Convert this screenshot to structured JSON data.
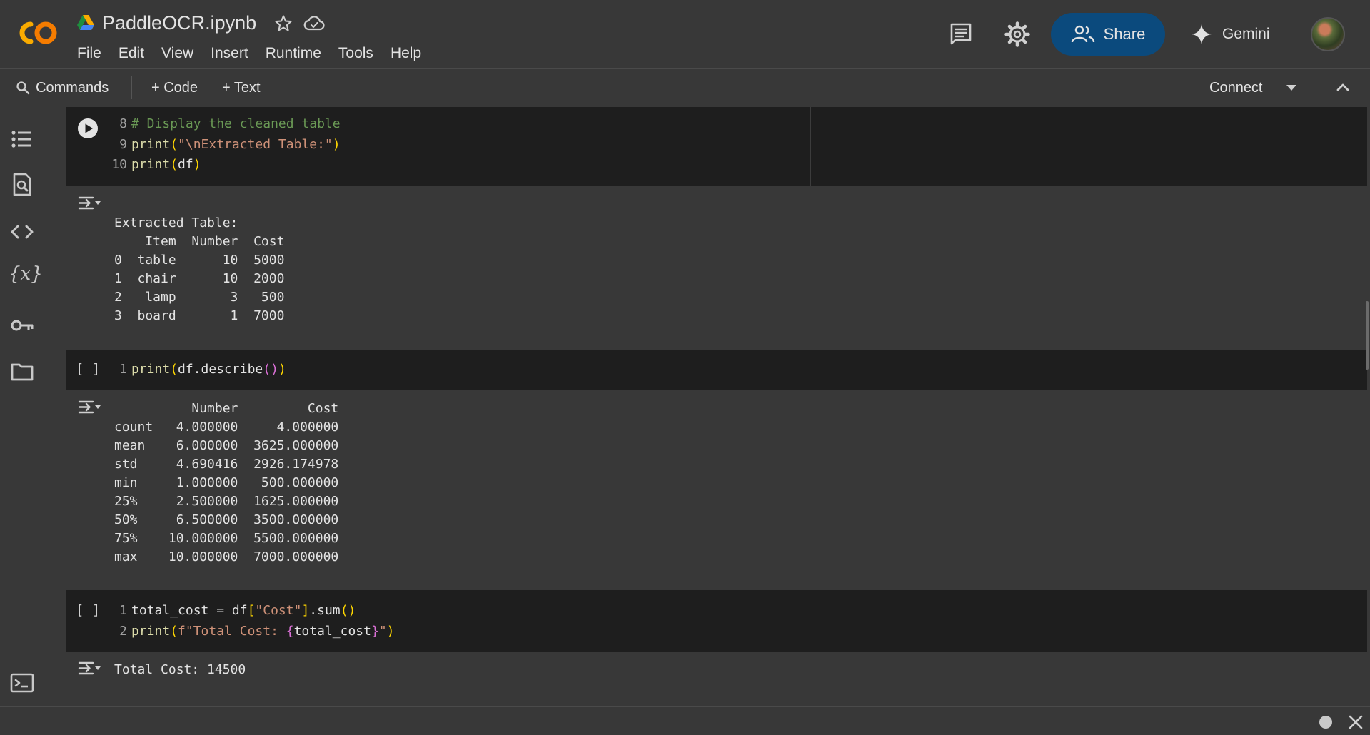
{
  "header": {
    "title": "PaddleOCR.ipynb",
    "menu": [
      "File",
      "Edit",
      "View",
      "Insert",
      "Runtime",
      "Tools",
      "Help"
    ],
    "share_label": "Share",
    "gemini_label": "Gemini",
    "colors": {
      "share_bg": "#0b4a7d",
      "logo_orange": "#f9ab00"
    }
  },
  "toolbar": {
    "commands_label": "Commands",
    "add_code_label": "+ Code",
    "add_text_label": "+ Text",
    "connect_label": "Connect"
  },
  "rail": {
    "icons": [
      "table-of-contents-icon",
      "find-icon",
      "code-snippets-icon",
      "variables-icon",
      "secrets-key-icon",
      "files-folder-icon",
      "terminal-icon"
    ],
    "variables_label": "{x}"
  },
  "cells": [
    {
      "lines": [
        {
          "n": "8",
          "text": "# Display the cleaned table"
        },
        {
          "n": "9",
          "text": "print(\"\\nExtracted Table:\")"
        },
        {
          "n": "10",
          "text": "print(df)"
        }
      ],
      "output": "Extracted Table:\n    Item  Number  Cost\n0  table      10  5000\n1  chair      10  2000\n2   lamp       3   500\n3  board       1  7000"
    },
    {
      "exec_marker": "[ ]",
      "lines": [
        {
          "n": "1",
          "text": "print(df.describe())"
        }
      ],
      "output": "          Number         Cost\ncount   4.000000     4.000000\nmean    6.000000  3625.000000\nstd     4.690416  2926.174978\nmin     1.000000   500.000000\n25%     2.500000  1625.000000\n50%     6.500000  3500.000000\n75%    10.000000  5500.000000\nmax    10.000000  7000.000000"
    },
    {
      "exec_marker": "[ ]",
      "lines": [
        {
          "n": "1",
          "text": "total_cost = df[\"Cost\"].sum()"
        },
        {
          "n": "2",
          "text": "print(f\"Total Cost: {total_cost}\")"
        }
      ],
      "output": "Total Cost: 14500"
    }
  ]
}
